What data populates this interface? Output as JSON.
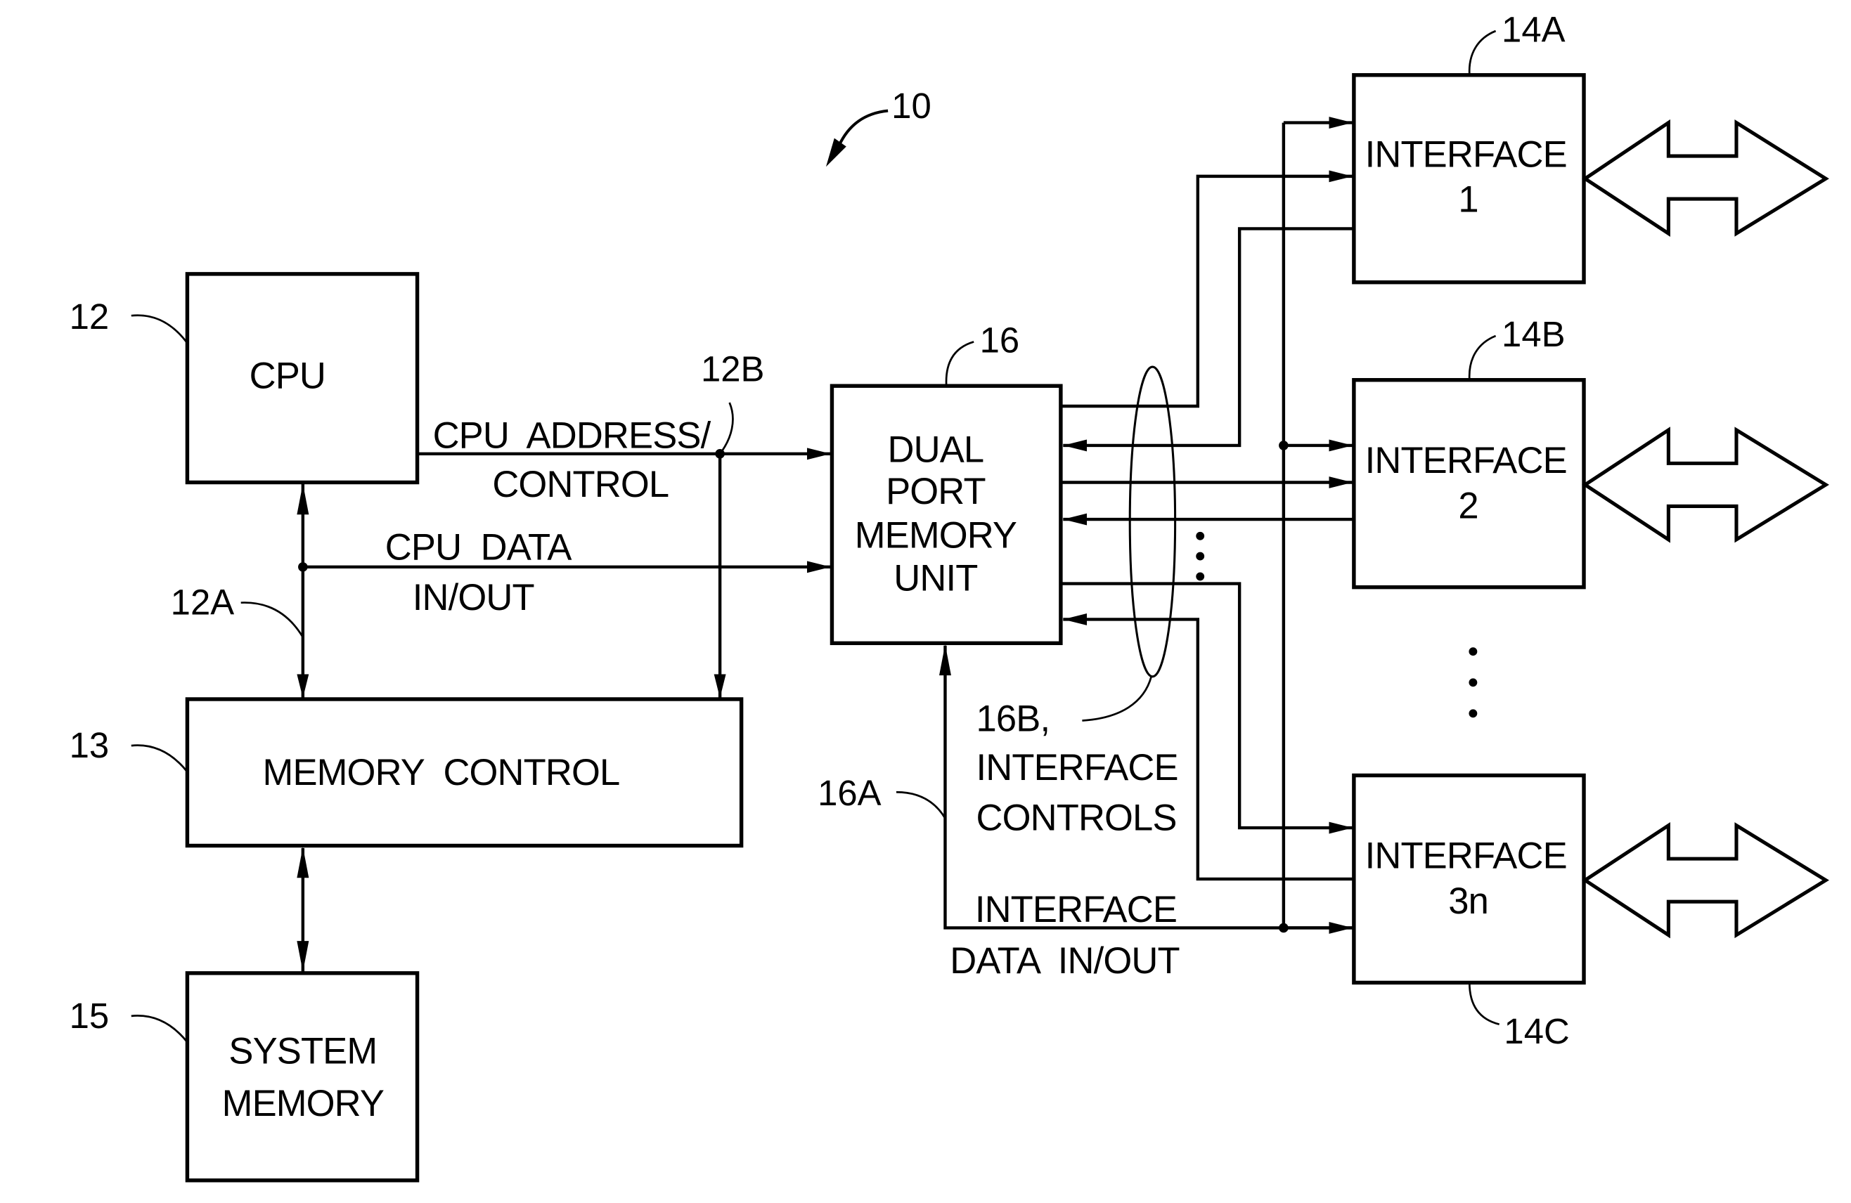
{
  "figure": {
    "reference": "10"
  },
  "blocks": {
    "cpu": {
      "label": [
        "CPU"
      ],
      "ref": "12"
    },
    "memory_control": {
      "label": [
        "MEMORY  CONTROL"
      ],
      "ref": "13"
    },
    "system_memory": {
      "label": [
        "SYSTEM",
        "MEMORY"
      ],
      "ref": "15"
    },
    "dual_port": {
      "label": [
        "DUAL",
        "PORT",
        "MEMORY",
        "UNIT"
      ],
      "ref": "16"
    },
    "interface_1": {
      "label": [
        "INTERFACE",
        "1"
      ],
      "ref": "14A"
    },
    "interface_2": {
      "label": [
        "INTERFACE",
        "2"
      ],
      "ref": "14B"
    },
    "interface_3n": {
      "label": [
        "INTERFACE",
        "3n"
      ],
      "ref": "14C"
    }
  },
  "buses": {
    "cpu_address": {
      "label": [
        "CPU  ADDRESS/",
        "CONTROL"
      ],
      "ref": "12B"
    },
    "cpu_data": {
      "label": [
        "CPU  DATA",
        "IN/OUT"
      ],
      "ref": "12A"
    },
    "interface_data": {
      "label": [
        "INTERFACE",
        "DATA  IN/OUT"
      ],
      "ref": "16A"
    },
    "interface_controls": {
      "label": [
        "16B,",
        "INTERFACE",
        "CONTROLS"
      ]
    }
  },
  "ellipsis": "⋮"
}
